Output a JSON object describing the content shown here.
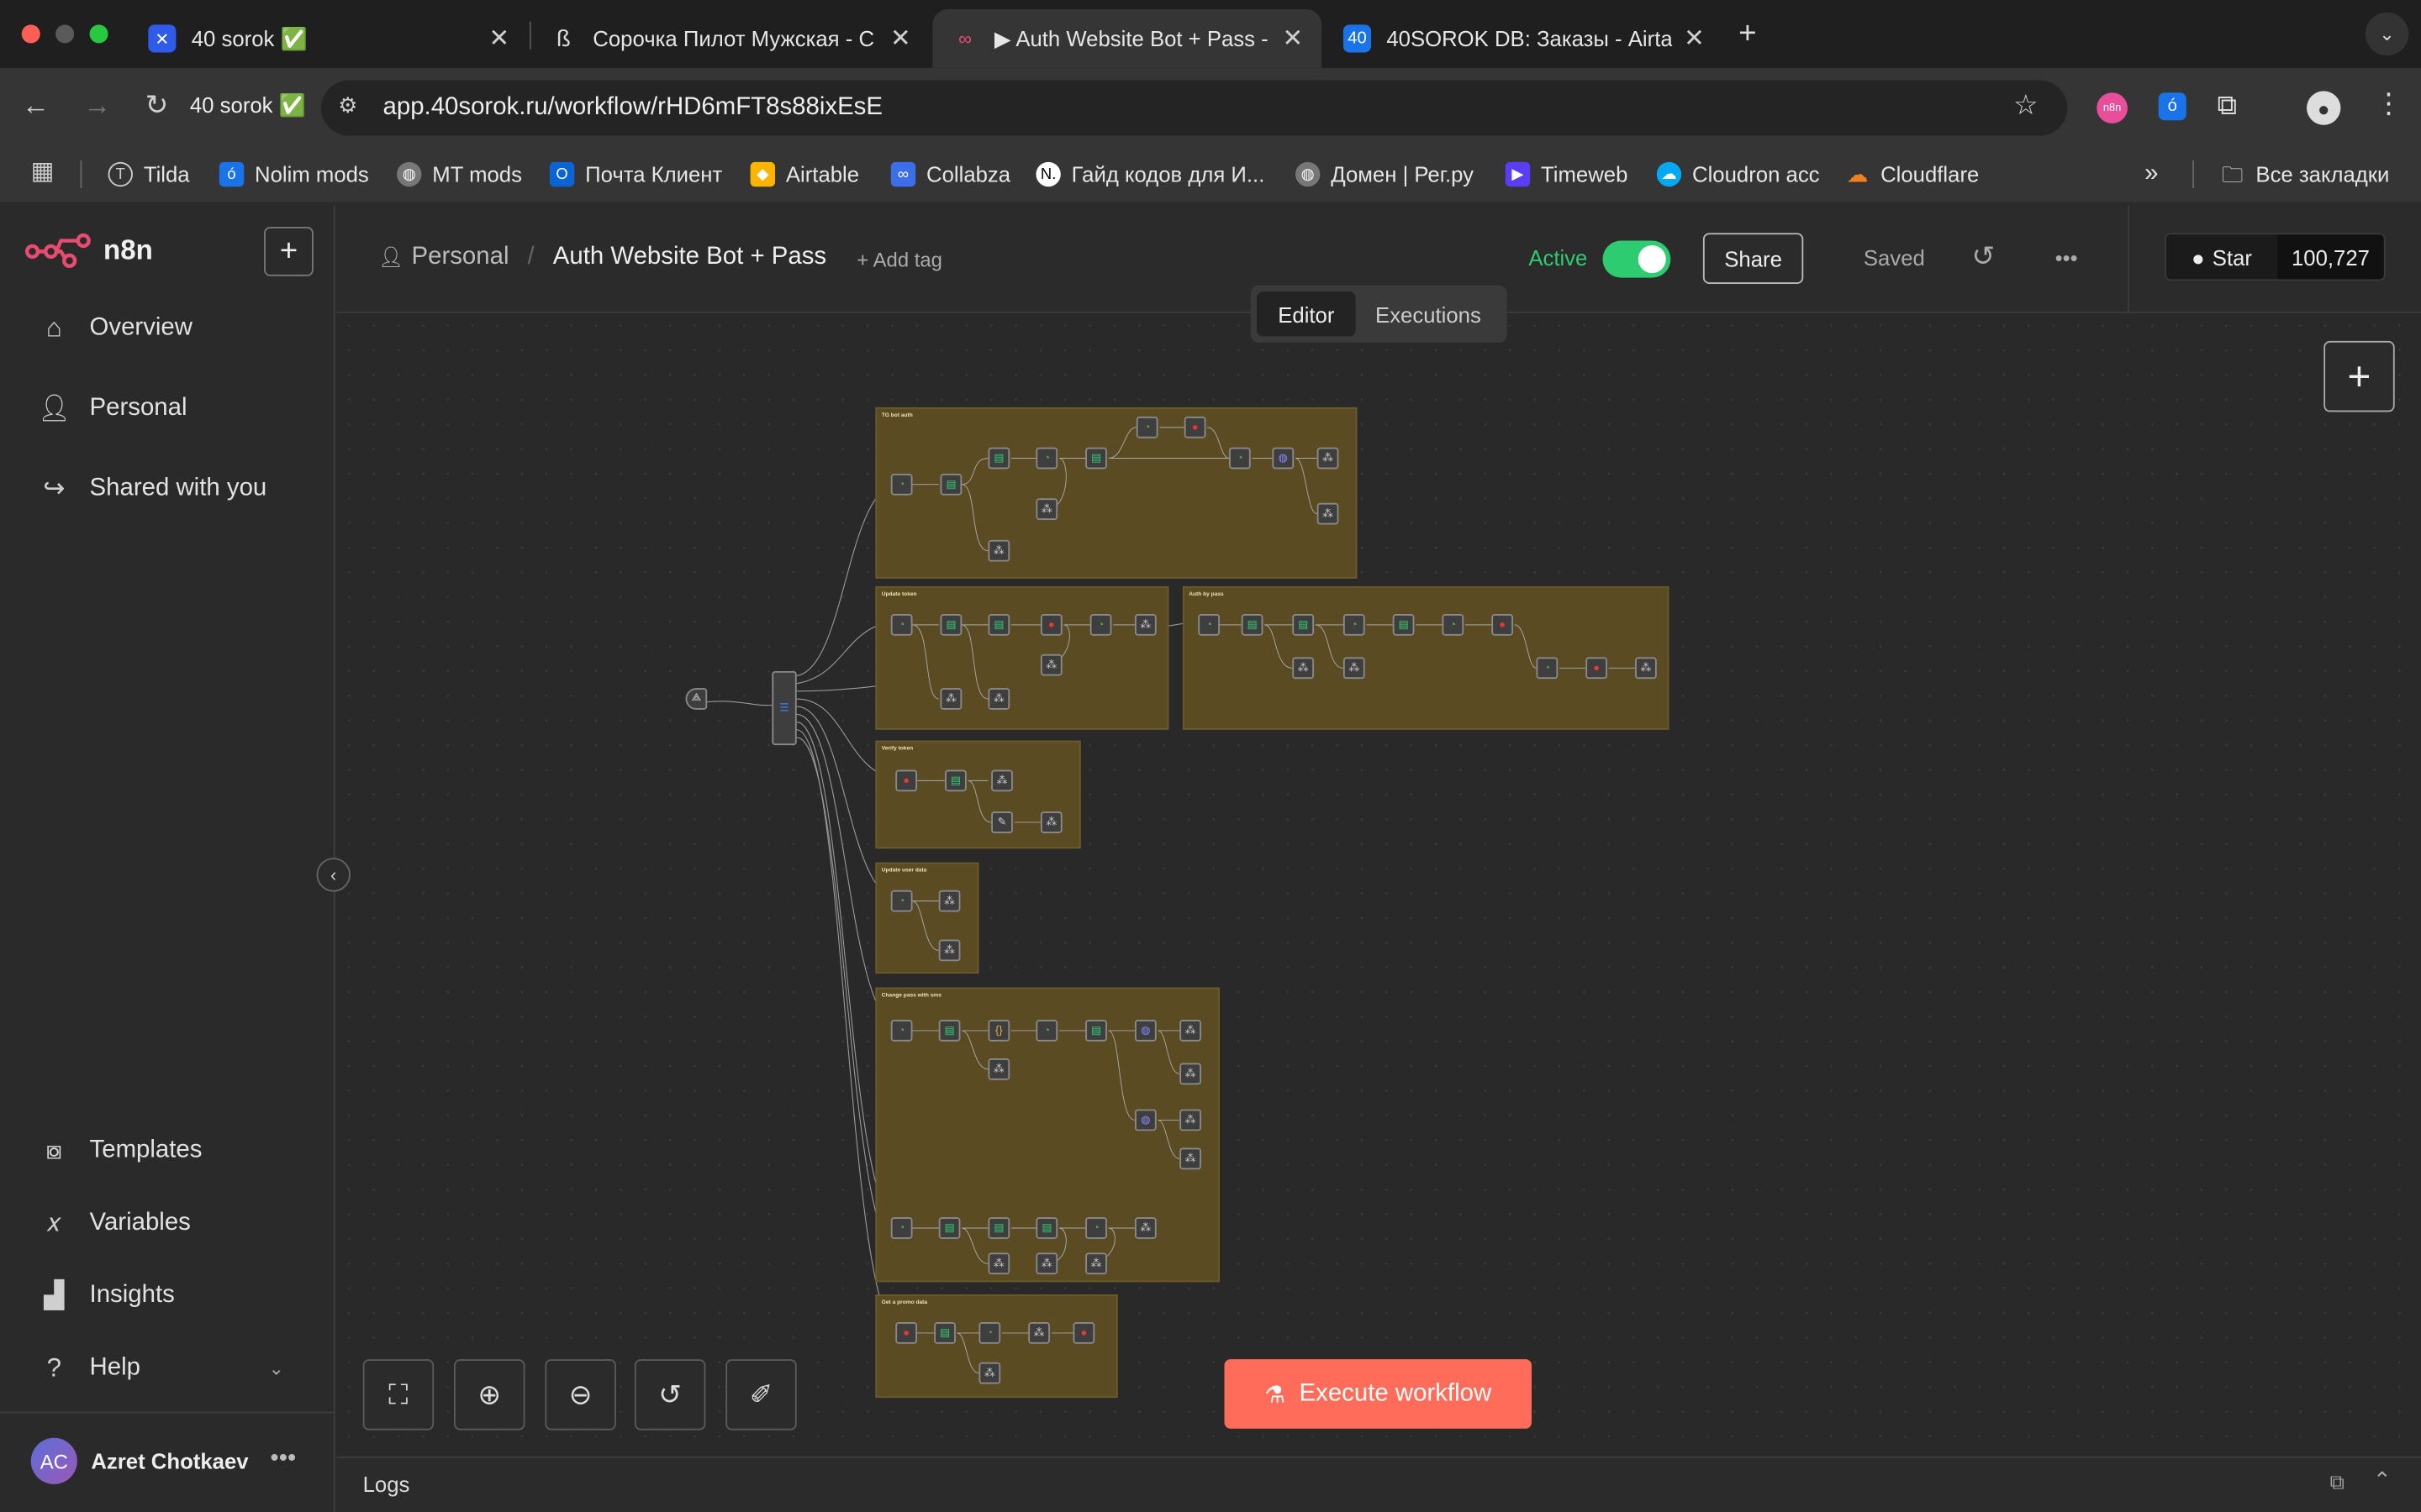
{
  "browser": {
    "tabs": [
      {
        "title": "40 sorok ✅",
        "active": false,
        "favicon": "flame"
      },
      {
        "title": "Сорочка Пилот Мужская - C",
        "active": false,
        "favicon": "feather"
      },
      {
        "title": "▶ Auth Website Bot + Pass - ",
        "active": true,
        "favicon": "n8n"
      },
      {
        "title": "40SOROK DB: Заказы - Airta",
        "active": false,
        "favicon": "40"
      }
    ],
    "profile_chip": "40 sorok ✅",
    "url": "app.40sorok.ru/workflow/rHD6mFT8s88ixEsE",
    "extension_badge": "n8n",
    "bookmarks": [
      "Tilda",
      "Nolim mods",
      "MT mods",
      "Почта Клиент",
      "Airtable",
      "Collabza",
      "Гайд кодов для И...",
      "Домен | Рег.ру",
      "Timeweb",
      "Cloudron acc",
      "Cloudflare"
    ],
    "more_bookmarks": "»",
    "all_bookmarks": "Все закладки",
    "colors": {
      "tab_strip": "#1f1f1f",
      "toolbar": "#353535"
    }
  },
  "app": {
    "logo": "n8n",
    "nav": {
      "overview": "Overview",
      "personal": "Personal",
      "shared": "Shared with you",
      "templates": "Templates",
      "variables": "Variables",
      "insights": "Insights",
      "help": "Help"
    },
    "user": {
      "initials": "AC",
      "name": "Azret Chotkaev"
    },
    "header": {
      "project": "Personal",
      "workflow_name": "Auth Website Bot + Pass",
      "add_tag": "+ Add tag",
      "active_label": "Active",
      "active": true,
      "share": "Share",
      "saved": "Saved",
      "star": "Star",
      "star_count": "100,727"
    },
    "tabs": {
      "editor": "Editor",
      "executions": "Executions"
    },
    "execute_button": "Execute workflow",
    "logs": "Logs",
    "colors": {
      "accent": "#ea4b71",
      "active_green": "#2ecc71",
      "execute": "#ff6d5a",
      "sticky": "#5a4b22"
    }
  },
  "workflow": {
    "stickies": [
      {
        "title": "TG bot auth",
        "subtitle": ""
      },
      {
        "title": "Update token",
        "subtitle": ""
      },
      {
        "title": "Auth by pass",
        "subtitle": ""
      },
      {
        "title": "Verify token",
        "subtitle": ""
      },
      {
        "title": "Update user data",
        "subtitle": ""
      },
      {
        "title": "Change pass with sms",
        "subtitle": ""
      },
      {
        "title": "Get a promo data",
        "subtitle": ""
      }
    ]
  }
}
